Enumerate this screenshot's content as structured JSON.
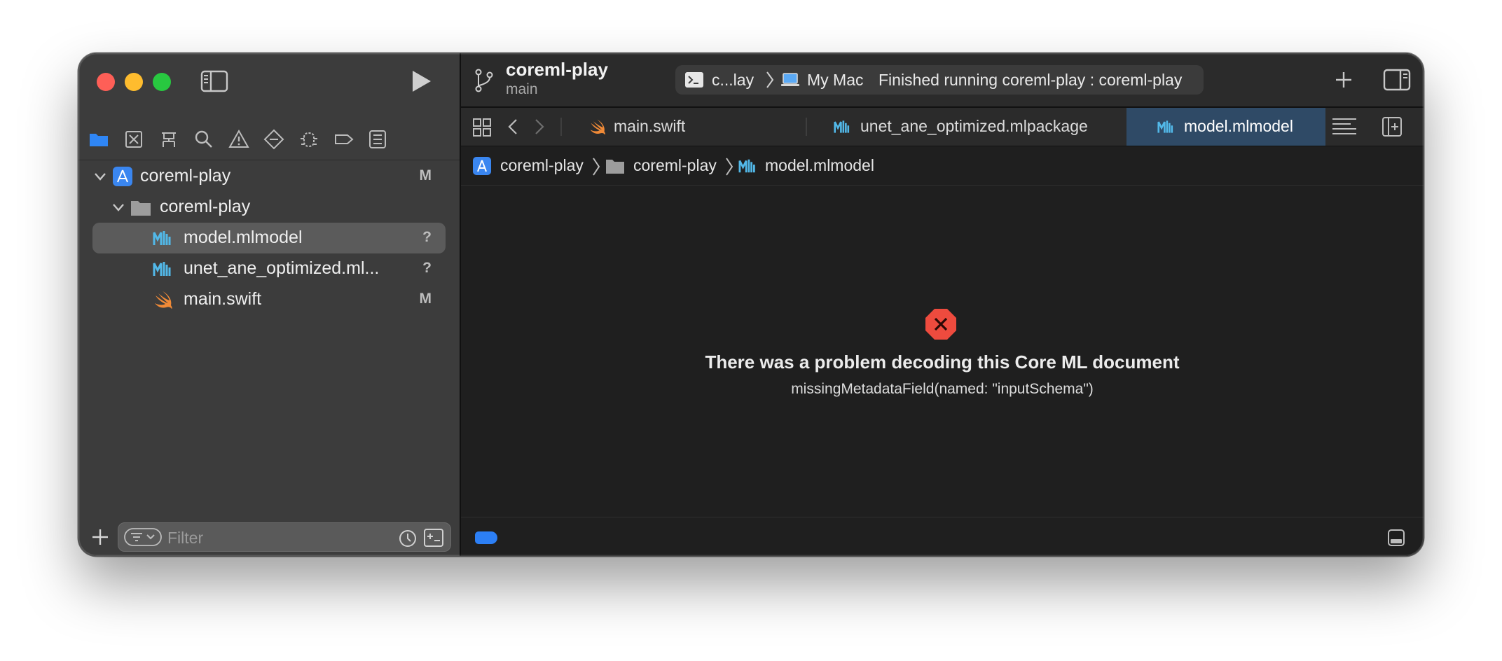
{
  "sidebar": {
    "tree": [
      {
        "label": "coreml-play",
        "badge": "M",
        "icon": "app-project-icon",
        "expanded": true
      },
      {
        "label": "coreml-play",
        "badge": "",
        "icon": "folder-icon",
        "expanded": true
      },
      {
        "label": "model.mlmodel",
        "badge": "?",
        "icon": "mlmodel-icon",
        "selected": true
      },
      {
        "label": "unet_ane_optimized.ml...",
        "badge": "?",
        "icon": "mlpackage-icon"
      },
      {
        "label": "main.swift",
        "badge": "M",
        "icon": "swift-icon"
      }
    ],
    "filter": {
      "placeholder": "Filter",
      "value": ""
    },
    "navigators": [
      "folder-icon",
      "source-control-icon",
      "symbol-icon",
      "search-icon",
      "issue-icon",
      "test-icon",
      "debug-icon",
      "breakpoint-icon",
      "report-icon"
    ]
  },
  "toolbar": {
    "project": "coreml-play",
    "branch": "main",
    "scheme": "c...lay",
    "destination": "My Mac",
    "status": "Finished running coreml-play : coreml-play"
  },
  "tabs": [
    {
      "label": "main.swift",
      "icon": "swift-icon",
      "active": false
    },
    {
      "label": "unet_ane_optimized.mlpackage",
      "icon": "mlpackage-icon",
      "active": false
    },
    {
      "label": "model.mlmodel",
      "icon": "mlmodel-icon",
      "active": true
    }
  ],
  "jumpbar": {
    "project": "coreml-play",
    "group": "coreml-play",
    "file": "model.mlmodel"
  },
  "content": {
    "error_title": "There was a problem decoding this Core ML document",
    "error_detail": "missingMetadataField(named: \"inputSchema\")"
  },
  "colors": {
    "accent": "#2c7ff5",
    "error": "#ee4b3e",
    "swift": "#f08a37",
    "mlmodel": "#52b8e8",
    "active_tab": "#2f4a66"
  }
}
